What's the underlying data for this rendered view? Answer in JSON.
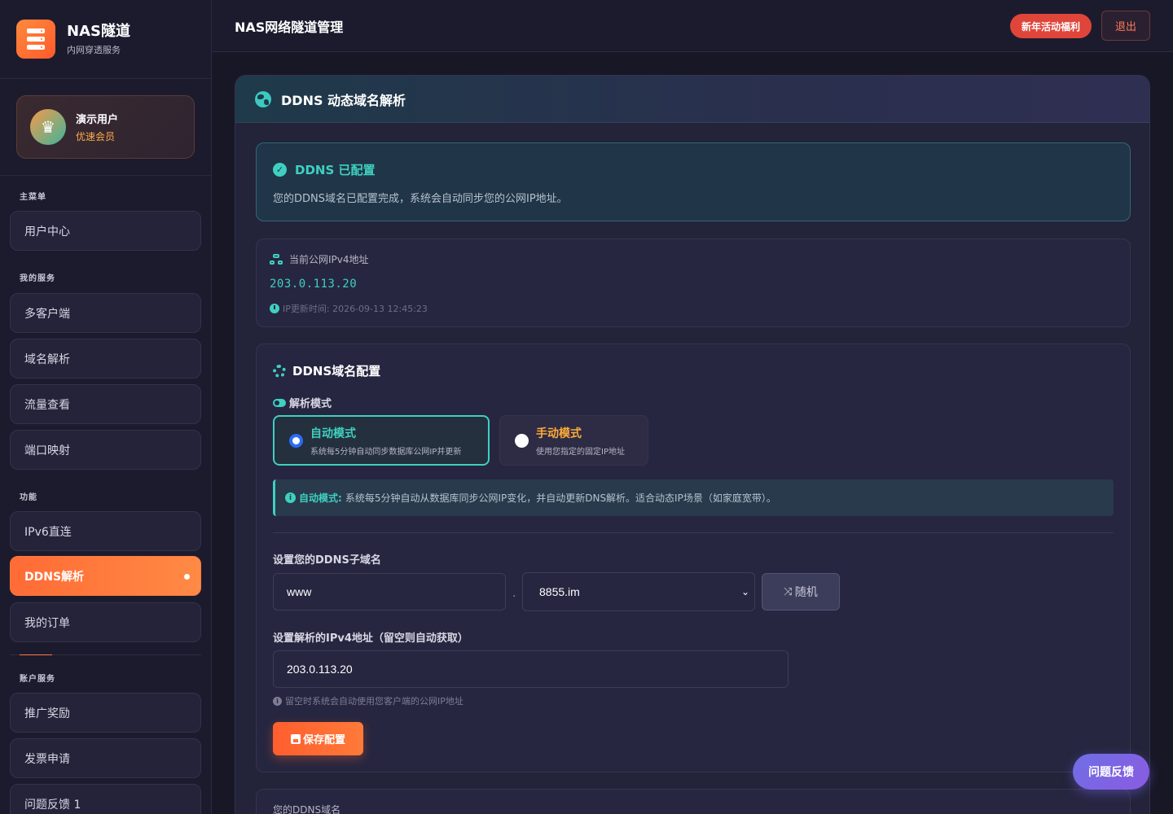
{
  "brand": {
    "name": "NAS隧道",
    "subtitle": "内网穿透服务"
  },
  "user": {
    "name": "演示用户",
    "level": "优速会员"
  },
  "sidebar": {
    "sections": [
      {
        "title": "主菜单"
      },
      {
        "title": "我的服务"
      },
      {
        "title": "功能"
      },
      {
        "title": "账户服务"
      }
    ],
    "items": [
      {
        "label": "用户中心"
      },
      {
        "label": "多客户端"
      },
      {
        "label": "域名解析"
      },
      {
        "label": "流量查看"
      },
      {
        "label": "端口映射"
      },
      {
        "label": "IPv6直连"
      },
      {
        "label": "DDNS解析",
        "active": true
      },
      {
        "label": "我的订单"
      },
      {
        "label": "推广奖励"
      },
      {
        "label": "发票申请"
      },
      {
        "label": "问题反馈 1"
      }
    ]
  },
  "header": {
    "title": "NAS网络隧道管理",
    "promo_label": "新年活动福利",
    "logout_label": "退出"
  },
  "panel": {
    "title": "DDNS 动态域名解析",
    "status": {
      "title": "DDNS 已配置",
      "description": "您的DDNS域名已配置完成，系统会自动同步您的公网IP地址。"
    },
    "ip": {
      "label": "当前公网IPv4地址",
      "value": "203.0.113.20",
      "updated": "IP更新时间: 2026-09-13 12:45:23"
    },
    "config": {
      "title": "DDNS域名配置",
      "mode_label": "解析模式",
      "modes": [
        {
          "name": "自动模式",
          "description": "系统每5分钟自动同步数据库公网IP并更新",
          "checked": true
        },
        {
          "name": "手动模式",
          "description": "使用您指定的固定IP地址",
          "checked": false
        }
      ],
      "info_strong": "自动模式:",
      "info_text": "系统每5分钟自动从数据库同步公网IP变化，并自动更新DNS解析。适合动态IP场景（如家庭宽带）。",
      "subdomain_label": "设置您的DDNS子域名",
      "subdomain_value": "www",
      "separator": ".",
      "domain_selected": "8855.im",
      "random_label": "随机",
      "ip_label": "设置解析的IPv4地址（留空则自动获取）",
      "ip_value": "203.0.113.20",
      "hint": "留空时系统会自动使用您客户端的公网IP地址",
      "save_label": "保存配置"
    },
    "domains_title": "您的DDNS域名"
  },
  "feedback_label": "问题反馈",
  "colors": {
    "accent_orange": "#ff6b35",
    "accent_teal": "#3fd0c0",
    "background": "#171726",
    "panel": "#232339"
  }
}
